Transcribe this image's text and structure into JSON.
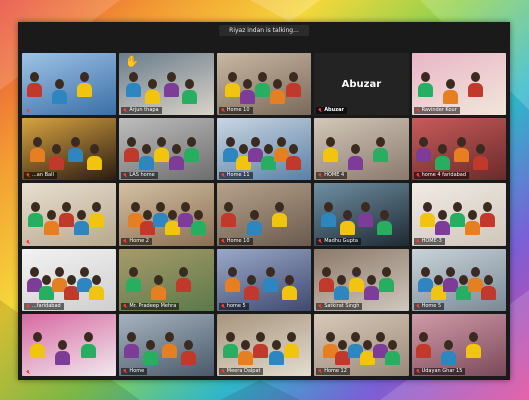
{
  "meeting": {
    "speaking_indicator": "Riyaz indan is talking..."
  },
  "tiles": [
    {
      "label": "",
      "theme": [
        "#3a6fa8",
        "#9fc3e6"
      ],
      "muted": true
    },
    {
      "label": "Arjun thapa",
      "theme": [
        "#d9d3c8",
        "#6a7d8c"
      ],
      "muted": true,
      "raised_hand": true
    },
    {
      "label": "Home 10",
      "theme": [
        "#7a6a5b",
        "#c8b7a2"
      ],
      "muted": true
    },
    {
      "label": "Abuzar",
      "theme": [
        "#232323",
        "#232323"
      ],
      "muted": true,
      "no_video": true
    },
    {
      "label": "Ravinder Kour",
      "theme": [
        "#f1e6da",
        "#e9b6c8"
      ],
      "muted": true
    },
    {
      "label": "...an Ball",
      "theme": [
        "#2b1c12",
        "#d8a441"
      ],
      "muted": true
    },
    {
      "label": "LAS home",
      "theme": [
        "#6e6e6e",
        "#bdbdbd"
      ],
      "muted": true
    },
    {
      "label": "Home 11",
      "theme": [
        "#5c80a6",
        "#c9d6e2"
      ],
      "muted": true
    },
    {
      "label": "HOME 4",
      "theme": [
        "#8a7a6e",
        "#d2c7b8"
      ],
      "muted": true
    },
    {
      "label": "home 4 faridabad",
      "theme": [
        "#6a2b2b",
        "#c85a5a"
      ],
      "muted": true
    },
    {
      "label": "",
      "theme": [
        "#b8a88f",
        "#e8dfcf"
      ],
      "muted": true
    },
    {
      "label": "Home 2",
      "theme": [
        "#8a6f55",
        "#d3c0a2"
      ],
      "muted": true
    },
    {
      "label": "Home 10",
      "theme": [
        "#6a5b4e",
        "#b7a28b"
      ],
      "muted": true
    },
    {
      "label": "Madhu Gupta",
      "theme": [
        "#1f2a33",
        "#6f8fa3"
      ],
      "muted": true
    },
    {
      "label": "HOME-3",
      "theme": [
        "#d0c6bb",
        "#f0ebe4"
      ],
      "muted": true
    },
    {
      "label": "...faridabad",
      "theme": [
        "#cfcfcf",
        "#f2f2f2"
      ],
      "muted": true
    },
    {
      "label": "Mr. Pradeep Mehra",
      "theme": [
        "#5b7a4a",
        "#a89a6a"
      ],
      "muted": true
    },
    {
      "label": "home 5",
      "theme": [
        "#3f4a6e",
        "#9aa8c9"
      ],
      "muted": true
    },
    {
      "label": "Satkirat Singh",
      "theme": [
        "#cfc7bd",
        "#8c7a6a"
      ],
      "muted": true
    },
    {
      "label": "Home 5",
      "theme": [
        "#7a8a96",
        "#c9d2d8"
      ],
      "muted": true
    },
    {
      "label": "",
      "theme": [
        "#f1e8ee",
        "#d86aa2"
      ],
      "muted": true
    },
    {
      "label": "Home",
      "theme": [
        "#4a5a6a",
        "#a6b3bf"
      ],
      "muted": true
    },
    {
      "label": "Meera Dalpat",
      "theme": [
        "#e3dccf",
        "#a8967e"
      ],
      "muted": true
    },
    {
      "label": "Home 12",
      "theme": [
        "#9a8a7a",
        "#d7c9b8"
      ],
      "muted": true
    },
    {
      "label": "Udayan Ghar 15",
      "theme": [
        "#7a4a5a",
        "#d19aa8"
      ],
      "muted": true
    }
  ]
}
